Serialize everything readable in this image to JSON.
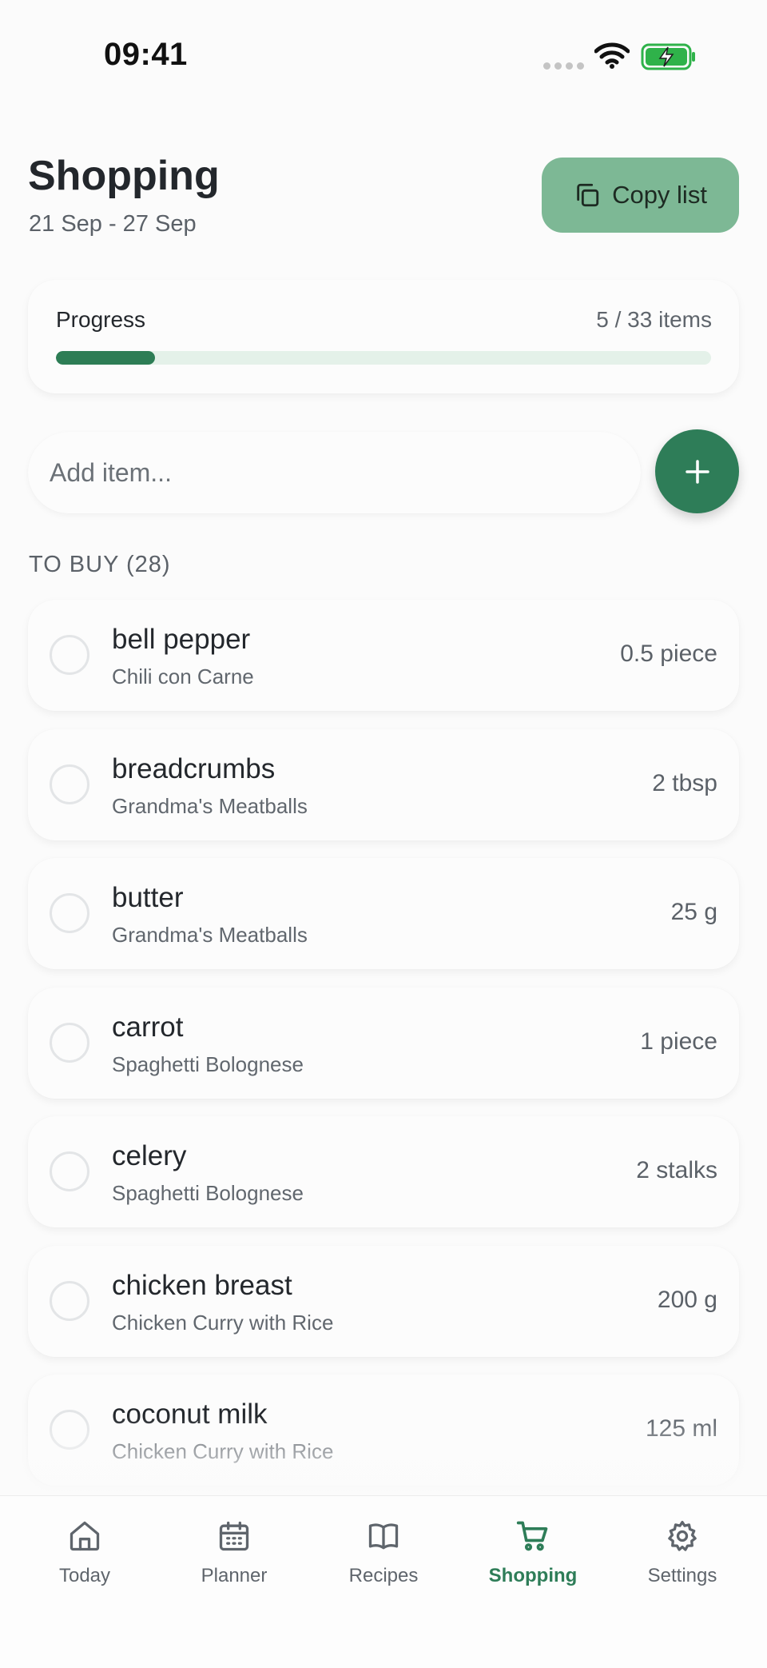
{
  "status_bar": {
    "time": "09:41"
  },
  "header": {
    "title": "Shopping",
    "date_range": "21 Sep - 27 Sep",
    "copy_button_label": "Copy list"
  },
  "progress": {
    "label": "Progress",
    "count_text": "5 / 33 items",
    "done": 5,
    "total": 33
  },
  "add_item": {
    "placeholder": "Add item..."
  },
  "to_buy": {
    "header": "TO BUY (28)",
    "items": [
      {
        "name": "bell pepper",
        "recipe": "Chili con Carne",
        "quantity": "0.5 piece"
      },
      {
        "name": "breadcrumbs",
        "recipe": "Grandma's Meatballs",
        "quantity": "2 tbsp"
      },
      {
        "name": "butter",
        "recipe": "Grandma's Meatballs",
        "quantity": "25 g"
      },
      {
        "name": "carrot",
        "recipe": "Spaghetti Bolognese",
        "quantity": "1 piece"
      },
      {
        "name": "celery",
        "recipe": "Spaghetti Bolognese",
        "quantity": "2 stalks"
      },
      {
        "name": "chicken breast",
        "recipe": "Chicken Curry with Rice",
        "quantity": "200 g"
      },
      {
        "name": "coconut milk",
        "recipe": "Chicken Curry with Rice",
        "quantity": "125 ml"
      }
    ]
  },
  "tab_bar": {
    "tabs": [
      {
        "label": "Today",
        "icon": "home-icon"
      },
      {
        "label": "Planner",
        "icon": "calendar-icon"
      },
      {
        "label": "Recipes",
        "icon": "book-icon"
      },
      {
        "label": "Shopping",
        "icon": "cart-icon",
        "active": true
      },
      {
        "label": "Settings",
        "icon": "gear-icon"
      }
    ]
  },
  "colors": {
    "accent": "#2e7d58",
    "copy_button_bg": "#7db895",
    "progress_track": "#e4f1e9"
  }
}
